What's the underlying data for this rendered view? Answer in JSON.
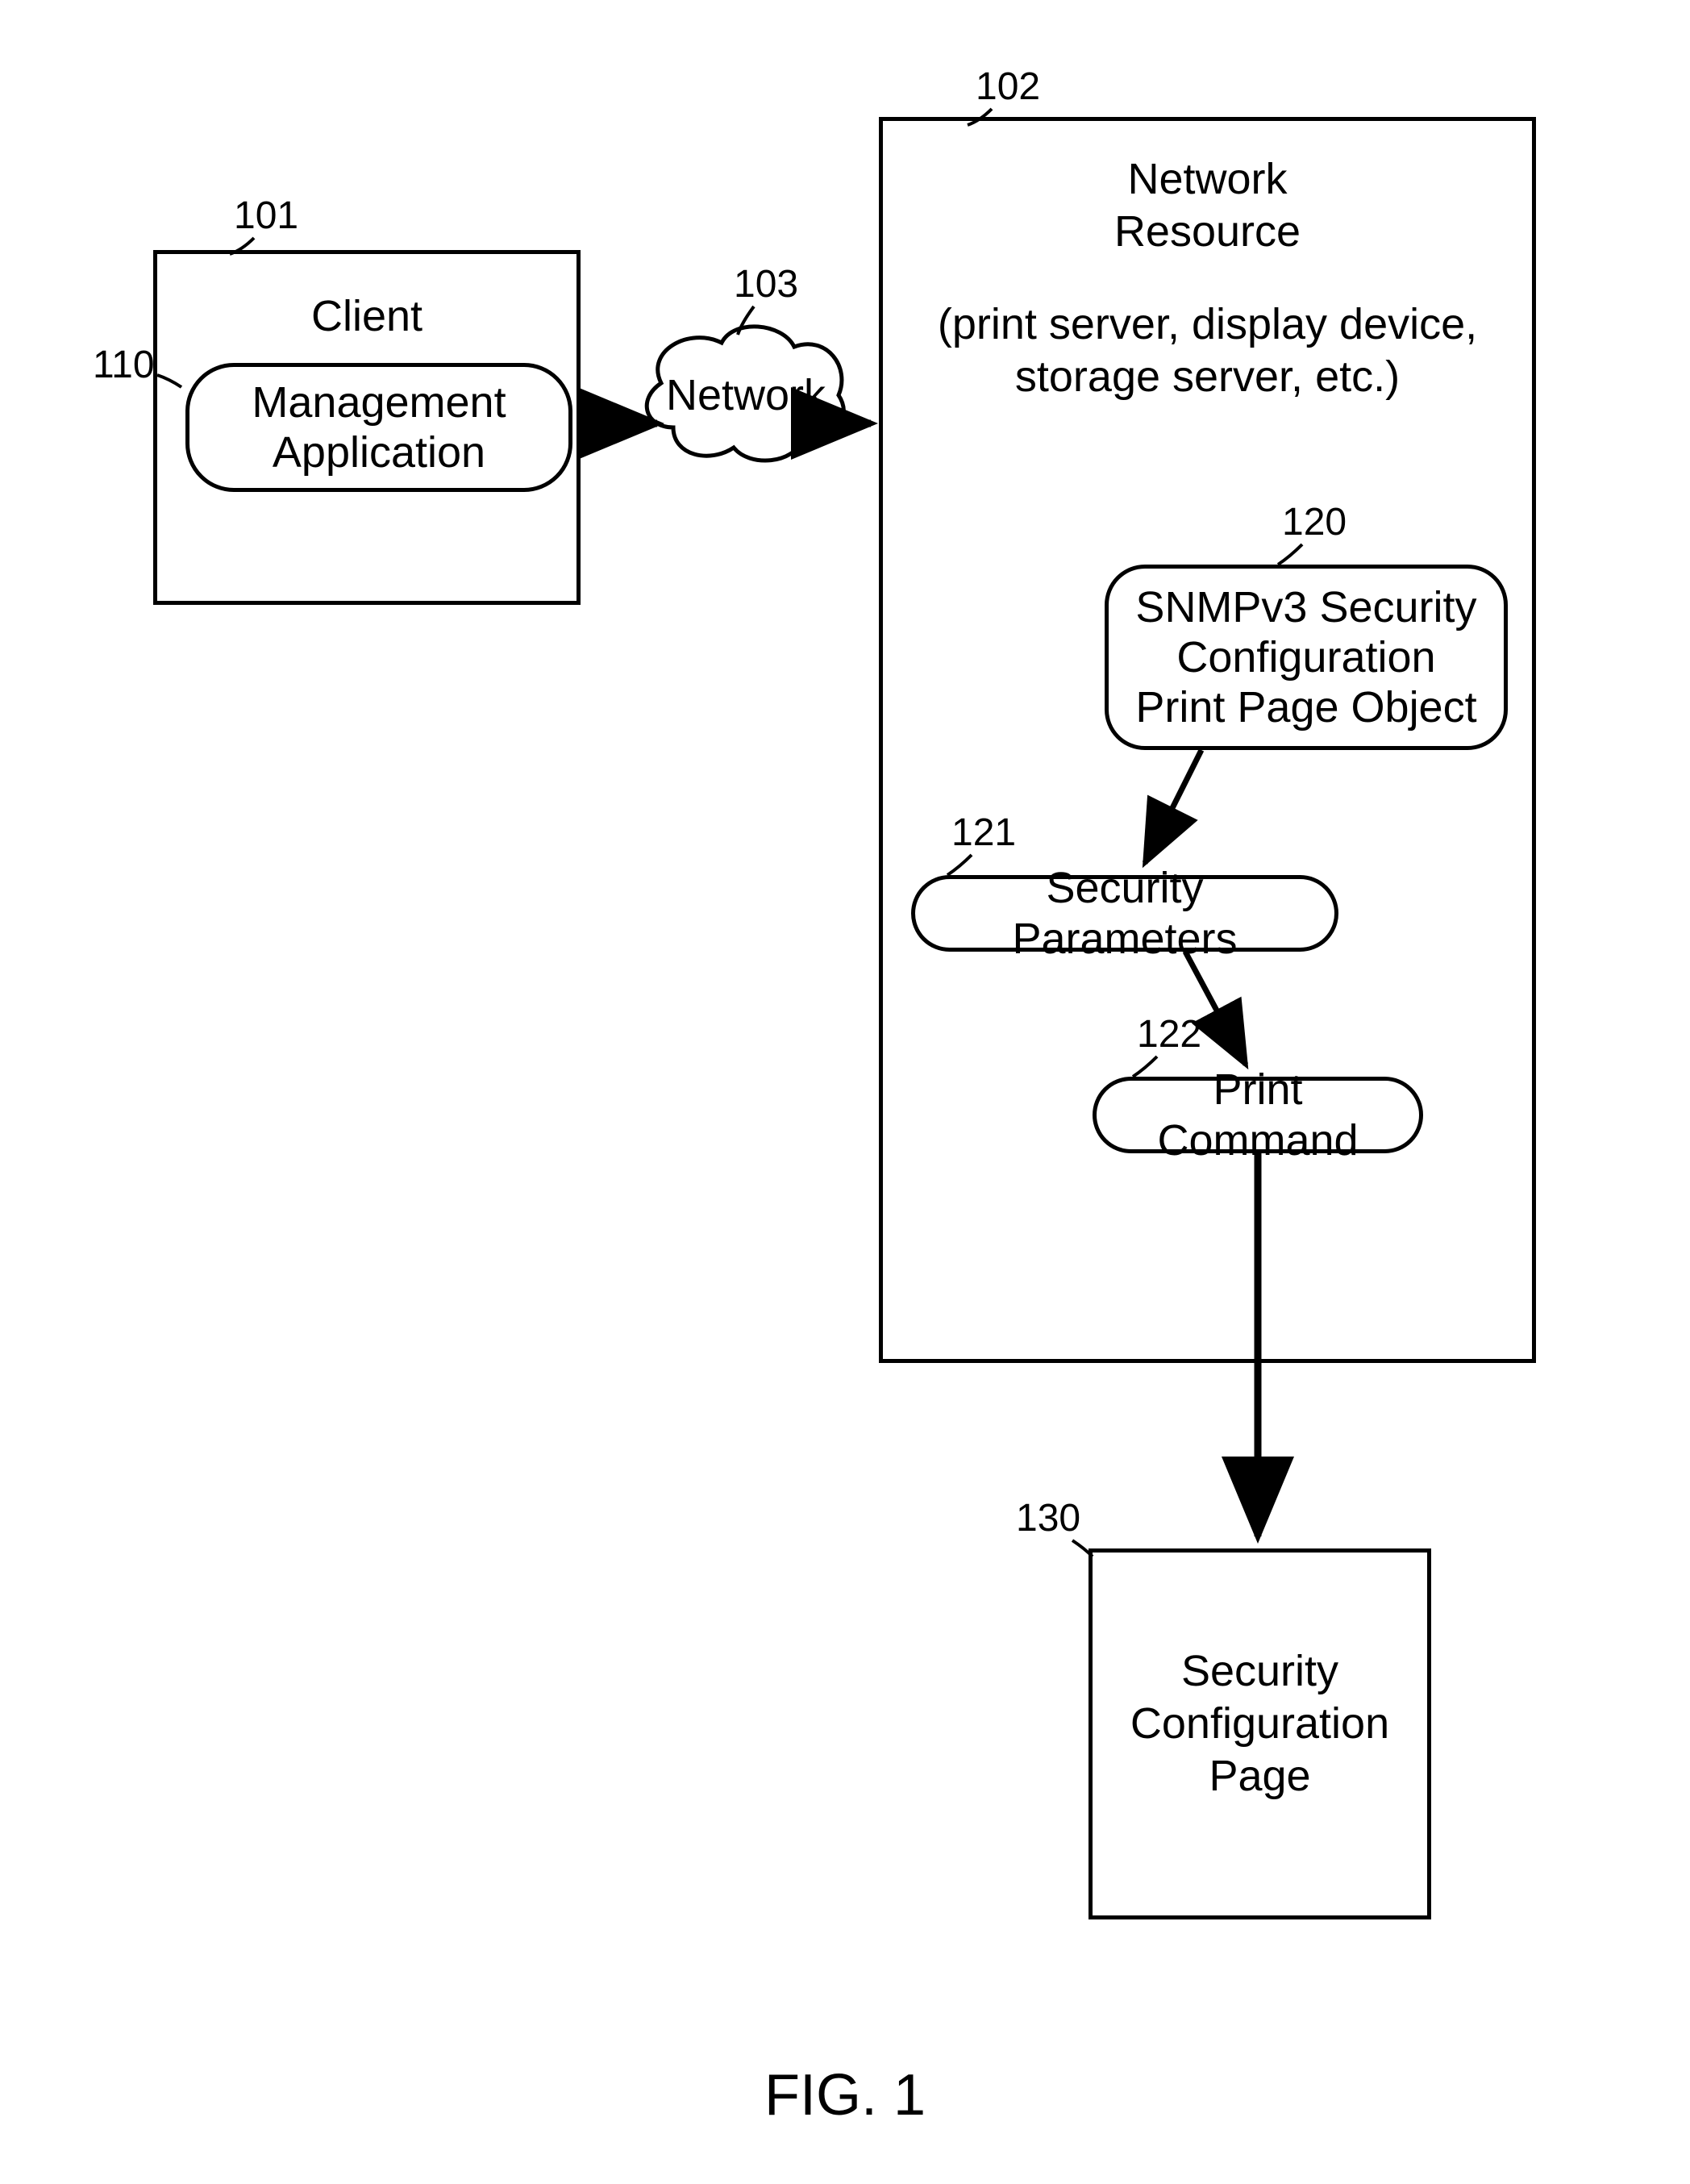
{
  "figure_caption": "FIG. 1",
  "refs": {
    "client": "101",
    "network_resource": "102",
    "network": "103",
    "mgmt_app": "110",
    "snmp_obj": "120",
    "sec_params": "121",
    "print_cmd": "122",
    "sec_page": "130"
  },
  "labels": {
    "client_title": "Client",
    "mgmt_app": "Management\nApplication",
    "network": "Network",
    "nr_title": "Network\nResource",
    "nr_subtitle": "(print server, display device,\nstorage server, etc.)",
    "snmp_obj": "SNMPv3 Security\nConfiguration\nPrint Page Object",
    "sec_params": "Security Parameters",
    "print_cmd": "Print Command",
    "sec_page": "Security\nConfiguration\nPage"
  }
}
